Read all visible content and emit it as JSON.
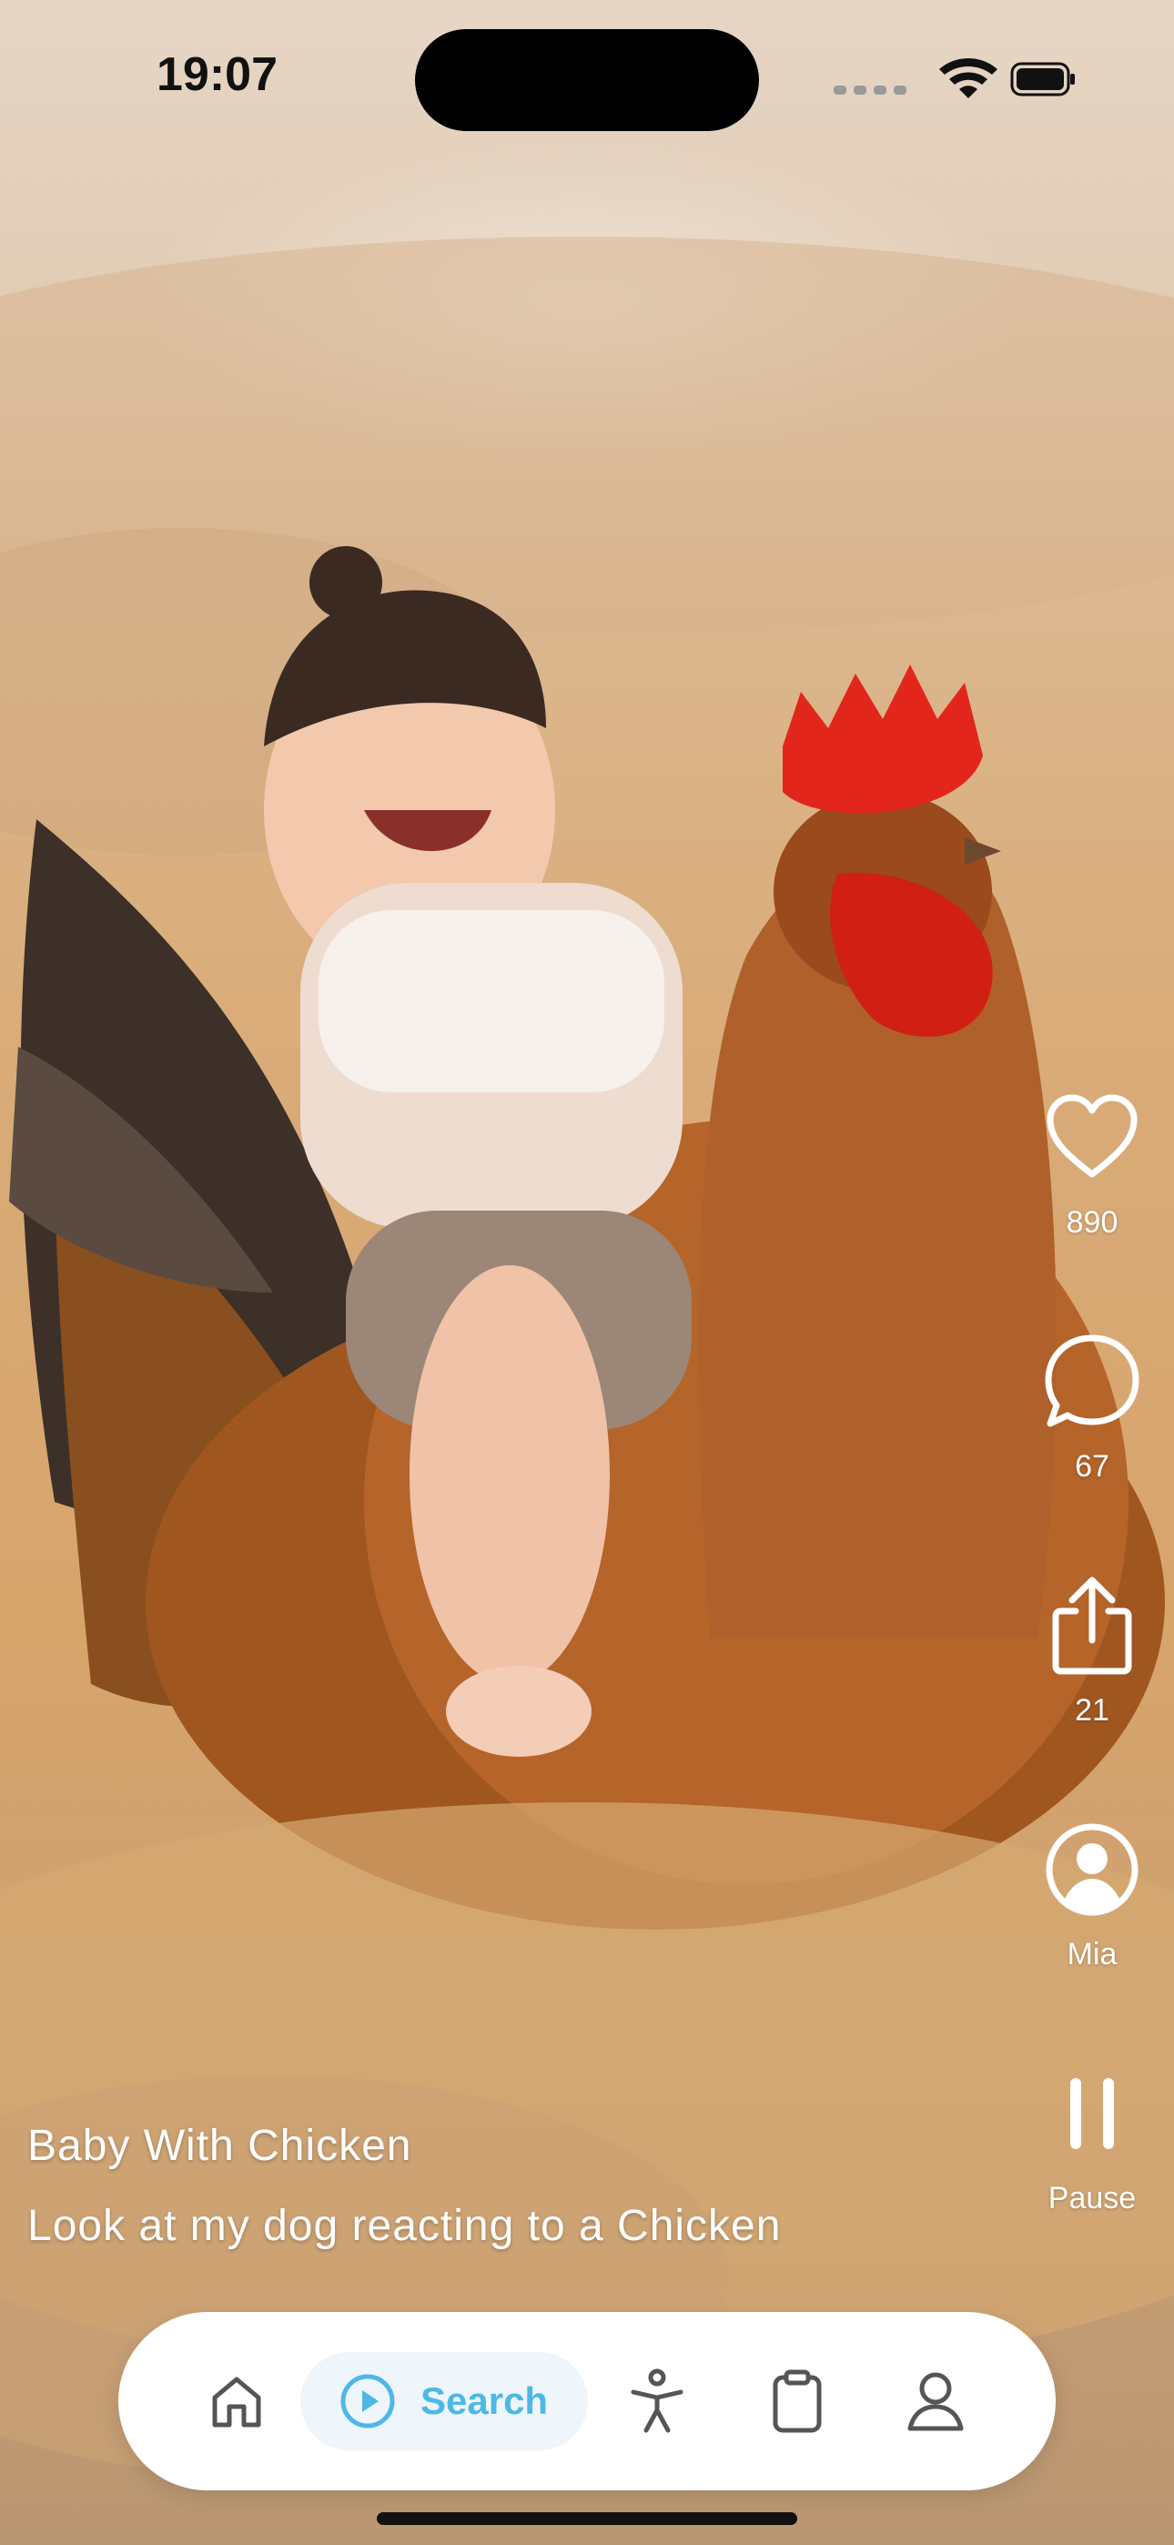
{
  "status_bar": {
    "time": "19:07",
    "icons": [
      "signal-dots-icon",
      "wifi-icon",
      "battery-icon"
    ]
  },
  "video": {
    "title": "Baby With Chicken",
    "description": "Look at my dog reacting to a Chicken"
  },
  "actions": {
    "like": {
      "icon": "heart-icon",
      "count": "890"
    },
    "comment": {
      "icon": "comment-bubble-icon",
      "count": "67"
    },
    "share": {
      "icon": "share-icon",
      "count": "21"
    },
    "author": {
      "icon": "user-circle-icon",
      "name": "Mia"
    },
    "playback": {
      "icon": "pause-icon",
      "label": "Pause"
    }
  },
  "tabbar": {
    "tabs": [
      {
        "icon": "home-icon",
        "label": ""
      },
      {
        "icon": "play-circle-icon",
        "label": "Search",
        "active": true
      },
      {
        "icon": "accessibility-icon",
        "label": ""
      },
      {
        "icon": "clipboard-icon",
        "label": ""
      },
      {
        "icon": "user-icon",
        "label": ""
      }
    ],
    "active_color": "#4DB8E6",
    "inactive_color": "#555555"
  }
}
